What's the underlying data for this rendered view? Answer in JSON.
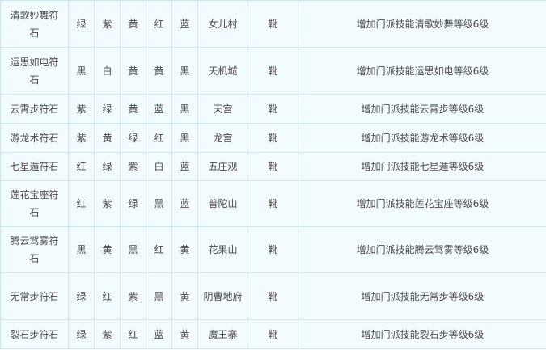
{
  "rows": [
    {
      "name": "清歌妙舞符石",
      "c1": "绿",
      "c2": "紫",
      "c3": "黄",
      "c4": "红",
      "c5": "蓝",
      "sect": "女儿村",
      "slot": "靴",
      "effect": "增加门派技能清歌妙舞等级6级"
    },
    {
      "name": "运思如电符石",
      "c1": "黑",
      "c2": "白",
      "c3": "黄",
      "c4": "黄",
      "c5": "黑",
      "sect": "天机城",
      "slot": "靴",
      "effect": "增加门派技能运思如电等级6级"
    },
    {
      "name": "云霄步符石",
      "c1": "紫",
      "c2": "绿",
      "c3": "黄",
      "c4": "蓝",
      "c5": "黑",
      "sect": "天宫",
      "slot": "靴",
      "effect": "增加门派技能云霄步等级6级"
    },
    {
      "name": "游龙术符石",
      "c1": "紫",
      "c2": "黄",
      "c3": "绿",
      "c4": "红",
      "c5": "黑",
      "sect": "龙宫",
      "slot": "靴",
      "effect": "增加门派技能游龙术等级6级"
    },
    {
      "name": "七星遁符石",
      "c1": "红",
      "c2": "绿",
      "c3": "紫",
      "c4": "白",
      "c5": "蓝",
      "sect": "五庄观",
      "slot": "靴",
      "effect": "增加门派技能七星遁等级6级"
    },
    {
      "name": "莲花宝座符石",
      "c1": "红",
      "c2": "紫",
      "c3": "绿",
      "c4": "黑",
      "c5": "蓝",
      "sect": "普陀山",
      "slot": "靴",
      "effect": "增加门派技能莲花宝座等级6级"
    },
    {
      "name": "腾云驾雾符石",
      "c1": "黑",
      "c2": "黄",
      "c3": "黑",
      "c4": "红",
      "c5": "黄",
      "sect": "花果山",
      "slot": "靴",
      "effect": "增加门派技能腾云驾雾等级6级"
    },
    {
      "name": "无常步符石",
      "c1": "绿",
      "c2": "红",
      "c3": "紫",
      "c4": "黑",
      "c5": "黄",
      "sect": "阴曹地府",
      "slot": "靴",
      "effect": "增加门派技能无常步等级6级"
    },
    {
      "name": "裂石步符石",
      "c1": "绿",
      "c2": "紫",
      "c3": "红",
      "c4": "蓝",
      "c5": "黄",
      "sect": "魔王寨",
      "slot": "靴",
      "effect": "增加门派技能裂石步等级6级"
    }
  ]
}
